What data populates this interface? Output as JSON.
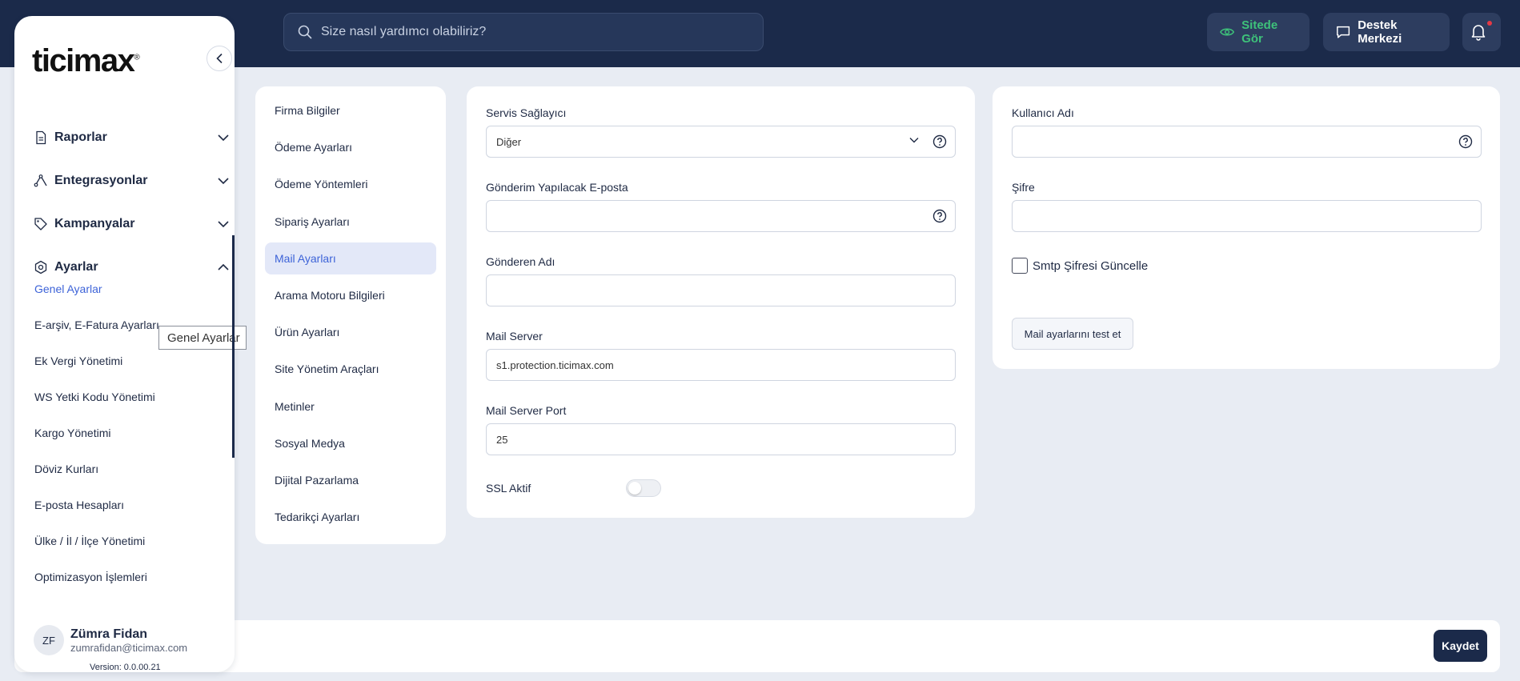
{
  "header": {
    "search_placeholder": "Size nasıl yardımcı olabiliriz?",
    "site_button": "Sitede Gör",
    "support_button": "Destek Merkezi"
  },
  "sidebar": {
    "logo": "ticimax",
    "groups": [
      {
        "label": "Raporlar",
        "icon": "document-icon",
        "expanded": false
      },
      {
        "label": "Entegrasyonlar",
        "icon": "integration-icon",
        "expanded": false
      },
      {
        "label": "Kampanyalar",
        "icon": "tag-icon",
        "expanded": false
      },
      {
        "label": "Ayarlar",
        "icon": "gear-icon",
        "expanded": true
      }
    ],
    "sub_items": [
      "Genel Ayarlar",
      "E-arşiv, E-Fatura Ayarları",
      "Ek Vergi Yönetimi",
      "WS Yetki Kodu Yönetimi",
      "Kargo Yönetimi",
      "Döviz Kurları",
      "E-posta Hesapları",
      "Ülke / İl / İlçe Yönetimi",
      "Optimizasyon İşlemleri"
    ],
    "tooltip": "Genel Ayarlar",
    "user": {
      "initials": "ZF",
      "name": "Zümra Fidan",
      "email": "zumrafidan@ticimax.com"
    },
    "version": "Version: 0.0.00.21"
  },
  "settings_menu": {
    "items": [
      "Firma Bilgiler",
      "Ödeme Ayarları",
      "Ödeme Yöntemleri",
      "Sipariş Ayarları",
      "Mail Ayarları",
      "Arama Motoru Bilgileri",
      "Ürün Ayarları",
      "Site Yönetim Araçları",
      "Metinler",
      "Sosyal Medya",
      "Dijital Pazarlama",
      "Tedarikçi Ayarları"
    ],
    "active": "Mail Ayarları"
  },
  "mail_form": {
    "provider_label": "Servis Sağlayıcı",
    "provider_value": "Diğer",
    "send_email_label": "Gönderim Yapılacak E-posta",
    "send_email_value": "",
    "sender_name_label": "Gönderen Adı",
    "sender_name_value": "",
    "server_label": "Mail Server",
    "server_value": "s1.protection.ticimax.com",
    "port_label": "Mail Server Port",
    "port_value": "25",
    "ssl_label": "SSL Aktif",
    "ssl_enabled": false
  },
  "auth_form": {
    "username_label": "Kullanıcı Adı",
    "username_value": "",
    "password_label": "Şifre",
    "password_value": "",
    "update_checkbox_label": "Smtp Şifresi Güncelle",
    "update_checked": false,
    "test_button": "Mail ayarlarını test et"
  },
  "footer": {
    "save_button": "Kaydet"
  },
  "colors": {
    "navy": "#1b2a4a",
    "accent_blue": "#3d63d8",
    "site_green": "#3ec27a",
    "background": "#e8ecf3"
  }
}
